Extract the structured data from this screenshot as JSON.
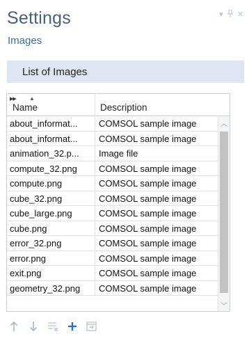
{
  "window": {
    "title": "Settings",
    "subtitle": "Images",
    "controls": {
      "menu_icon": "chevron-down-icon",
      "pin_icon": "pin-icon",
      "close_icon": "close-icon"
    }
  },
  "section": {
    "label": "List of Images"
  },
  "table": {
    "columns": [
      "Name",
      "Description"
    ],
    "rows": [
      {
        "name": "about_informat...",
        "description": "COMSOL sample image"
      },
      {
        "name": "about_informat...",
        "description": "COMSOL sample image"
      },
      {
        "name": "animation_32.p...",
        "description": "Image file"
      },
      {
        "name": "compute_32.png",
        "description": "COMSOL sample image"
      },
      {
        "name": "compute.png",
        "description": "COMSOL sample image"
      },
      {
        "name": "cube_32.png",
        "description": "COMSOL sample image"
      },
      {
        "name": "cube_large.png",
        "description": "COMSOL sample image"
      },
      {
        "name": "cube.png",
        "description": "COMSOL sample image"
      },
      {
        "name": "error_32.png",
        "description": "COMSOL sample image"
      },
      {
        "name": "error.png",
        "description": "COMSOL sample image"
      },
      {
        "name": "exit.png",
        "description": "COMSOL sample image"
      },
      {
        "name": "geometry_32.png",
        "description": "COMSOL sample image"
      }
    ]
  },
  "toolbar": {
    "buttons": [
      "move-up-icon",
      "move-down-icon",
      "clear-list-icon",
      "add-icon",
      "import-icon"
    ]
  },
  "colors": {
    "title": "#4a5f78",
    "subtitle": "#3a6ea8",
    "section_bg": "#dde6f1",
    "accent": "#2f6db5"
  }
}
